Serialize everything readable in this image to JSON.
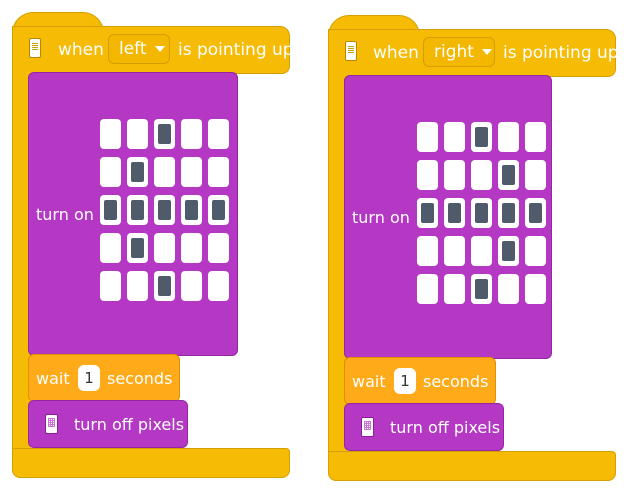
{
  "stacks": [
    {
      "hat": {
        "when": "when",
        "dropdown": "left",
        "suffix": "is pointing up"
      },
      "turn_on": {
        "label": "turn on",
        "pixels": [
          [
            0,
            0,
            1,
            0,
            0
          ],
          [
            0,
            1,
            0,
            0,
            0
          ],
          [
            1,
            1,
            1,
            1,
            1
          ],
          [
            0,
            1,
            0,
            0,
            0
          ],
          [
            0,
            0,
            1,
            0,
            0
          ]
        ]
      },
      "wait": {
        "prefix": "wait",
        "value": "1",
        "suffix": "seconds"
      },
      "turn_off": {
        "label": "turn off pixels"
      }
    },
    {
      "hat": {
        "when": "when",
        "dropdown": "right",
        "suffix": "is pointing up"
      },
      "turn_on": {
        "label": "turn on",
        "pixels": [
          [
            0,
            0,
            1,
            0,
            0
          ],
          [
            0,
            0,
            0,
            1,
            0
          ],
          [
            1,
            1,
            1,
            1,
            1
          ],
          [
            0,
            0,
            0,
            1,
            0
          ],
          [
            0,
            0,
            1,
            0,
            0
          ]
        ]
      },
      "wait": {
        "prefix": "wait",
        "value": "1",
        "suffix": "seconds"
      },
      "turn_off": {
        "label": "turn off pixels"
      }
    }
  ],
  "colors": {
    "event_yellow": "#f5bb05",
    "display_purple": "#b438c4",
    "control_orange": "#ffab19",
    "pixel_on": "#4f5a6b"
  },
  "icons": {
    "hat": "device-icon",
    "turn_off": "pixel-grid-icon"
  }
}
